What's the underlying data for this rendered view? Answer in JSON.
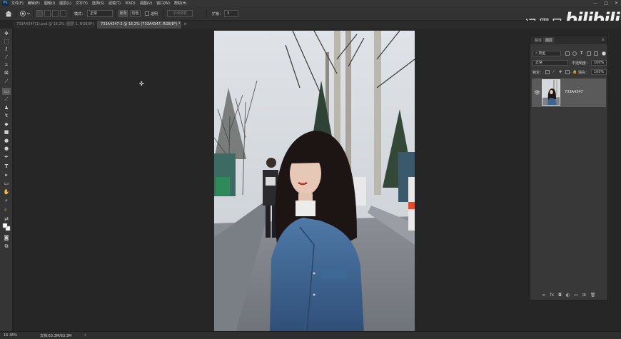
{
  "menubar": {
    "logo": "Ps",
    "items": [
      "文件(F)",
      "编辑(E)",
      "图像(I)",
      "图层(L)",
      "文字(Y)",
      "选择(S)",
      "滤镜(T)",
      "3D(D)",
      "视图(V)",
      "窗口(W)",
      "帮助(H)"
    ],
    "window_controls": [
      "—",
      "□",
      "✕"
    ]
  },
  "options": {
    "mode_label": "模式：",
    "mode_value": "正常",
    "reverse_label": "反向",
    "dither_label": "仿色",
    "transparency_label": "透明",
    "smooth_label": "平滑渐变",
    "expand_label": "扩散：",
    "expand_value": "3"
  },
  "watermark": {
    "name": "冯墨风",
    "logo": "bilibili"
  },
  "tabs": [
    {
      "label": "733A4347(1).psd @ 16.2% (图层 1, RGB/8*)",
      "close": "×",
      "active": false
    },
    {
      "label": "733A4347-2 @ 16.2% (733A4347, RGB/8*) *",
      "close": "×",
      "active": true
    }
  ],
  "layers_panel": {
    "tab_paths": "路径",
    "tab_layers": "图层",
    "menu": "≡",
    "filter_kind": "类型",
    "blend_mode": "正常",
    "opacity_label": "不透明度：",
    "opacity_value": "100%",
    "lock_label": "锁定：",
    "fill_label": "填充：",
    "fill_value": "100%",
    "layer_name": "733A4347",
    "bottom_icons": [
      "∞",
      "fx",
      "◘",
      "◐",
      "▭",
      "⊞",
      "🗑"
    ]
  },
  "status": {
    "zoom": "16.36%",
    "doc": "文档:63.3M/63.3M",
    "arrow": "›"
  }
}
